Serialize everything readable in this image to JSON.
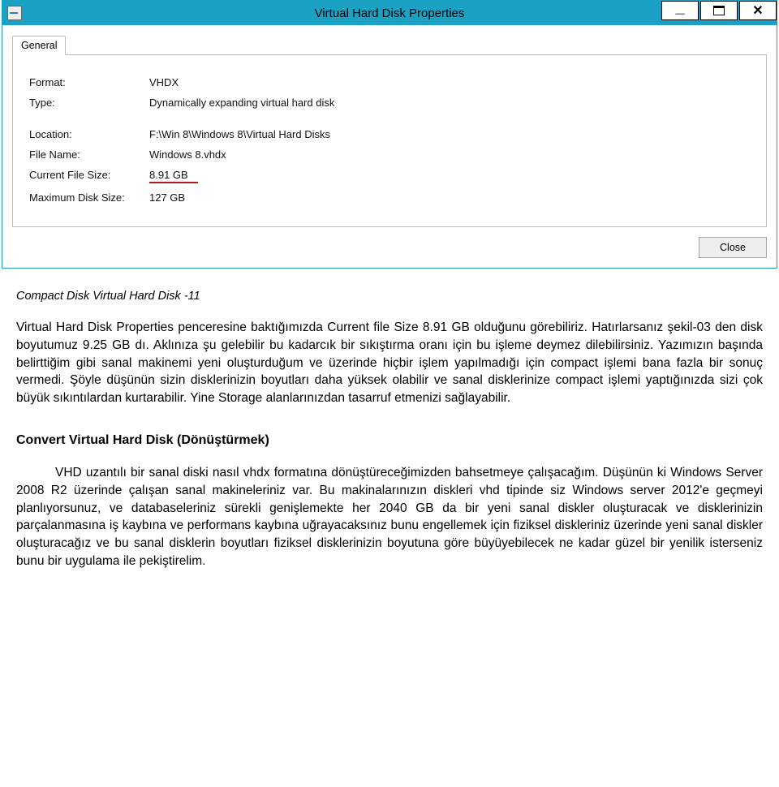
{
  "window": {
    "title": "Virtual Hard Disk Properties",
    "tab_label": "General",
    "close_label": "Close",
    "fields": {
      "format_label": "Format:",
      "format_value": "VHDX",
      "type_label": "Type:",
      "type_value": "Dynamically expanding virtual hard disk",
      "location_label": "Location:",
      "location_value": "F:\\Win 8\\Windows 8\\Virtual Hard Disks",
      "filename_label": "File Name:",
      "filename_value": "Windows 8.vhdx",
      "cursize_label": "Current File Size:",
      "cursize_value": "8.91 GB",
      "maxsize_label": "Maximum Disk Size:",
      "maxsize_value": "127 GB"
    }
  },
  "article": {
    "caption": "Compact Disk Virtual Hard Disk -11",
    "paragraph1": "Virtual Hard Disk Properties penceresine baktığımızda Current file Size 8.91 GB olduğunu görebiliriz. Hatırlarsanız şekil-03 den disk boyutumuz 9.25 GB dı. Aklınıza şu gelebilir bu kadarcık bir sıkıştırma oranı için bu işleme deymez dilebilirsiniz. Yazımızın başında belirttiğim gibi sanal makinemi yeni oluşturduğum ve üzerinde hiçbir işlem yapılmadığı için compact işlemi bana fazla bir sonuç vermedi. Şöyle düşünün sizin disklerinizin boyutları daha yüksek olabilir ve sanal disklerinize compact işlemi yaptığınızda sizi çok büyük sıkıntılardan kurtarabilir. Yine Storage alanlarınızdan tasarruf etmenizi sağlayabilir.",
    "heading": "Convert Virtual Hard Disk (Dönüştürmek)",
    "paragraph2": "VHD uzantılı bir sanal diski nasıl vhdx formatına dönüştüreceğimizden bahsetmeye çalışacağım. Düşünün ki Windows Server 2008 R2 üzerinde çalışan sanal makineleriniz var. Bu makinalarınızın diskleri vhd tipinde siz Windows server 2012'e geçmeyi planlıyorsunuz, ve databaseleriniz sürekli genişlemekte her 2040 GB da bir yeni sanal diskler oluşturacak ve disklerinizin parçalanmasına iş kaybına ve performans kaybına uğrayacaksınız bunu engellemek için fiziksel diskleriniz üzerinde yeni sanal diskler oluşturacağız ve bu sanal disklerin boyutları fiziksel disklerinizin boyutuna göre büyüyebilecek ne kadar güzel bir yenilik isterseniz bunu bir uygulama ile pekiştirelim."
  }
}
